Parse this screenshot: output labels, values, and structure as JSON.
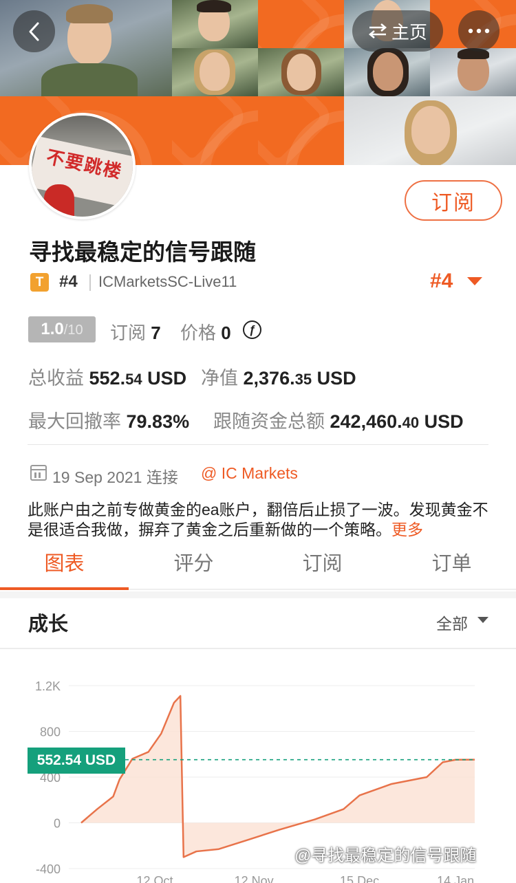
{
  "nav": {
    "back_icon": "chevron-left-icon",
    "home_label": "主页",
    "home_icon": "swap-arrows-icon",
    "more_icon": "more-dots-icon"
  },
  "profile": {
    "subscribe_label": "订阅",
    "title": "寻找最稳定的信号跟随",
    "type_badge": "T",
    "rank_small": "#4",
    "account": "ICMarketsSC-Live11",
    "rank_big": "#4",
    "score": "1.0",
    "score_max": "/10",
    "subscribe_count_label": "订阅",
    "subscribe_count": "7",
    "price_label": "价格",
    "price": "0",
    "currency_symbol": "ƒ",
    "total_profit_label": "总收益",
    "total_profit_int": "552.",
    "total_profit_dec": "54",
    "total_profit_unit": "USD",
    "equity_label": "净值",
    "equity_int": "2,376.",
    "equity_dec": "35",
    "equity_unit": "USD",
    "max_drawdown_label": "最大回撤率",
    "max_drawdown": "79.83%",
    "follow_funds_label": "跟随资金总额",
    "follow_funds_int": "242,460.",
    "follow_funds_dec": "40",
    "follow_funds_unit": "USD",
    "connect_date": "19 Sep 2021",
    "connect_label": "连接",
    "broker": "@ IC Markets",
    "description": "此账户由之前专做黄金的ea账户，翻倍后止损了一波。发现黄金不是很适合我做，摒弃了黄金之后重新做的一个策略。",
    "more_label": "更多"
  },
  "tabs": [
    {
      "label": "图表",
      "active": true
    },
    {
      "label": "评分",
      "active": false
    },
    {
      "label": "订阅",
      "active": false
    },
    {
      "label": "订单",
      "active": false
    }
  ],
  "growth": {
    "title": "成长",
    "filter": "全部",
    "current_value": "552.54 USD"
  },
  "watermark": "@寻找最稳定的信号跟随",
  "colors": {
    "accent": "#ee5a24",
    "value_tag": "#15a07c",
    "line": "#e8734a"
  },
  "chart_data": {
    "type": "area",
    "yticks": [
      "1.2K",
      "800",
      "400",
      "0",
      "-400"
    ],
    "ylim": [
      -400,
      1200
    ],
    "xticks": [
      "12 Oct",
      "12 Nov",
      "15 Dec",
      "14 Jan"
    ],
    "x": [
      "2021-09-19",
      "2021-09-24",
      "2021-09-29",
      "2021-10-01",
      "2021-10-05",
      "2021-10-10",
      "2021-10-14",
      "2021-10-18",
      "2021-10-20",
      "2021-10-21",
      "2021-10-25",
      "2021-11-01",
      "2021-11-10",
      "2021-11-20",
      "2021-12-01",
      "2021-12-10",
      "2021-12-15",
      "2021-12-25",
      "2022-01-05",
      "2022-01-10",
      "2022-01-14",
      "2022-01-20"
    ],
    "values": [
      0,
      120,
      230,
      380,
      560,
      620,
      780,
      1050,
      1110,
      -300,
      -250,
      -230,
      -150,
      -60,
      30,
      120,
      240,
      340,
      400,
      530,
      552,
      552.54
    ],
    "reference_line": 552.54,
    "grid": true
  }
}
